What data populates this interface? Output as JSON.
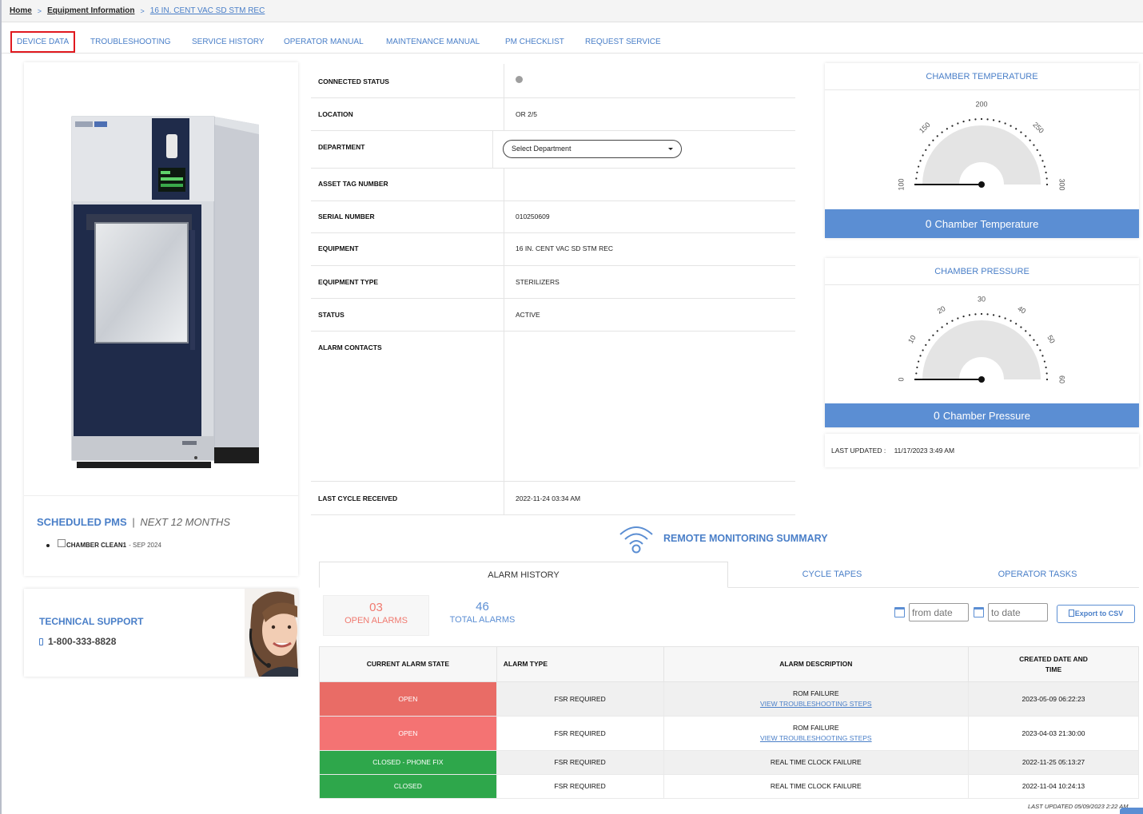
{
  "breadcrumb": {
    "home": "Home",
    "section": "Equipment Information",
    "current": "16 IN. CENT VAC SD STM REC",
    "separator": ">"
  },
  "tabs": [
    {
      "label": "DEVICE DATA",
      "active": true
    },
    {
      "label": "TROUBLESHOOTING"
    },
    {
      "label": "SERVICE HISTORY"
    },
    {
      "label": "OPERATOR MANUAL"
    },
    {
      "label": "MAINTENANCE MANUAL"
    },
    {
      "label": "PM CHECKLIST"
    },
    {
      "label": "REQUEST SERVICE"
    }
  ],
  "scheduled_pms": {
    "title": "SCHEDULED PMS",
    "divider": "|",
    "range": "NEXT 12 MONTHS",
    "items": [
      {
        "name": "CHAMBER CLEAN1",
        "date": "- SEP 2024"
      }
    ]
  },
  "support": {
    "title": "TECHNICAL SUPPORT",
    "phone": "1-800-333-8828"
  },
  "device_info": {
    "connected_status": {
      "label": "CONNECTED STATUS",
      "color": "#9e9e9e"
    },
    "location": {
      "label": "LOCATION",
      "value": "OR 2/5"
    },
    "department": {
      "label": "DEPARTMENT",
      "placeholder": "Select Department"
    },
    "asset_tag": {
      "label": "ASSET TAG NUMBER",
      "value": ""
    },
    "serial": {
      "label": "SERIAL NUMBER",
      "value": "010250609"
    },
    "equipment": {
      "label": "EQUIPMENT",
      "value": "16 IN. CENT VAC SD STM REC"
    },
    "equipment_type": {
      "label": "EQUIPMENT TYPE",
      "value": "STERILIZERS"
    },
    "status": {
      "label": "STATUS",
      "value": "ACTIVE"
    },
    "alarm_contacts": {
      "label": "ALARM CONTACTS",
      "value": ""
    },
    "last_cycle": {
      "label": "LAST CYCLE RECEIVED",
      "value": "2022-11-24 03:34 AM"
    }
  },
  "gauges": {
    "temperature": {
      "title": "CHAMBER TEMPERATURE",
      "value": "0",
      "label": "Chamber Temperature",
      "ticks": [
        "100",
        "150",
        "200",
        "250",
        "300"
      ],
      "min": 100,
      "max": 300,
      "reading": 0
    },
    "pressure": {
      "title": "CHAMBER PRESSURE",
      "value": "0",
      "label": "Chamber Pressure",
      "ticks": [
        "0",
        "10",
        "20",
        "30",
        "40",
        "50",
        "60"
      ],
      "min": 0,
      "max": 60,
      "reading": 0
    },
    "last_updated_label": "LAST UPDATED :",
    "last_updated_value": "11/17/2023 3:49 AM",
    "bar_color": "#5b8ed3"
  },
  "remote_summary": {
    "title": "REMOTE MONITORING SUMMARY",
    "icon": "wifi-icon"
  },
  "bottom_tabs": [
    {
      "label": "ALARM HISTORY",
      "active": true
    },
    {
      "label": "CYCLE TAPES"
    },
    {
      "label": "OPERATOR TASKS"
    }
  ],
  "alarm_counts": {
    "open_count": "03",
    "open_label": "OPEN ALARMS",
    "total_count": "46",
    "total_label": "TOTAL ALARMS"
  },
  "filters": {
    "from_placeholder": "from date",
    "to_placeholder": "to date",
    "export_label": "Export to CSV"
  },
  "alarm_table": {
    "headers": [
      "CURRENT ALARM STATE",
      "ALARM TYPE",
      "ALARM DESCRIPTION",
      "CREATED DATE AND TIME"
    ],
    "rows": [
      {
        "state": "OPEN",
        "type": "FSR REQUIRED",
        "description": "ROM FAILURE",
        "link": "VIEW TROUBLESHOOTING STEPS",
        "created": "2023-05-09 06:22:23"
      },
      {
        "state": "OPEN",
        "type": "FSR REQUIRED",
        "description": "ROM FAILURE",
        "link": "VIEW TROUBLESHOOTING STEPS",
        "created": "2023-04-03 21:30:00"
      },
      {
        "state": "CLOSED - PHONE FIX",
        "type": "FSR REQUIRED",
        "description": "REAL TIME CLOCK FAILURE",
        "link": "",
        "created": "2022-11-25 05:13:27"
      },
      {
        "state": "CLOSED",
        "type": "FSR REQUIRED",
        "description": "REAL TIME CLOCK FAILURE",
        "link": "",
        "created": "2022-11-04 10:24:13"
      }
    ],
    "status_colors": {
      "open": "#e96c66",
      "closed": "#2ea74b"
    }
  },
  "footer": {
    "last_updated": "LAST UPDATED 05/09/2023 2:22 AM"
  }
}
